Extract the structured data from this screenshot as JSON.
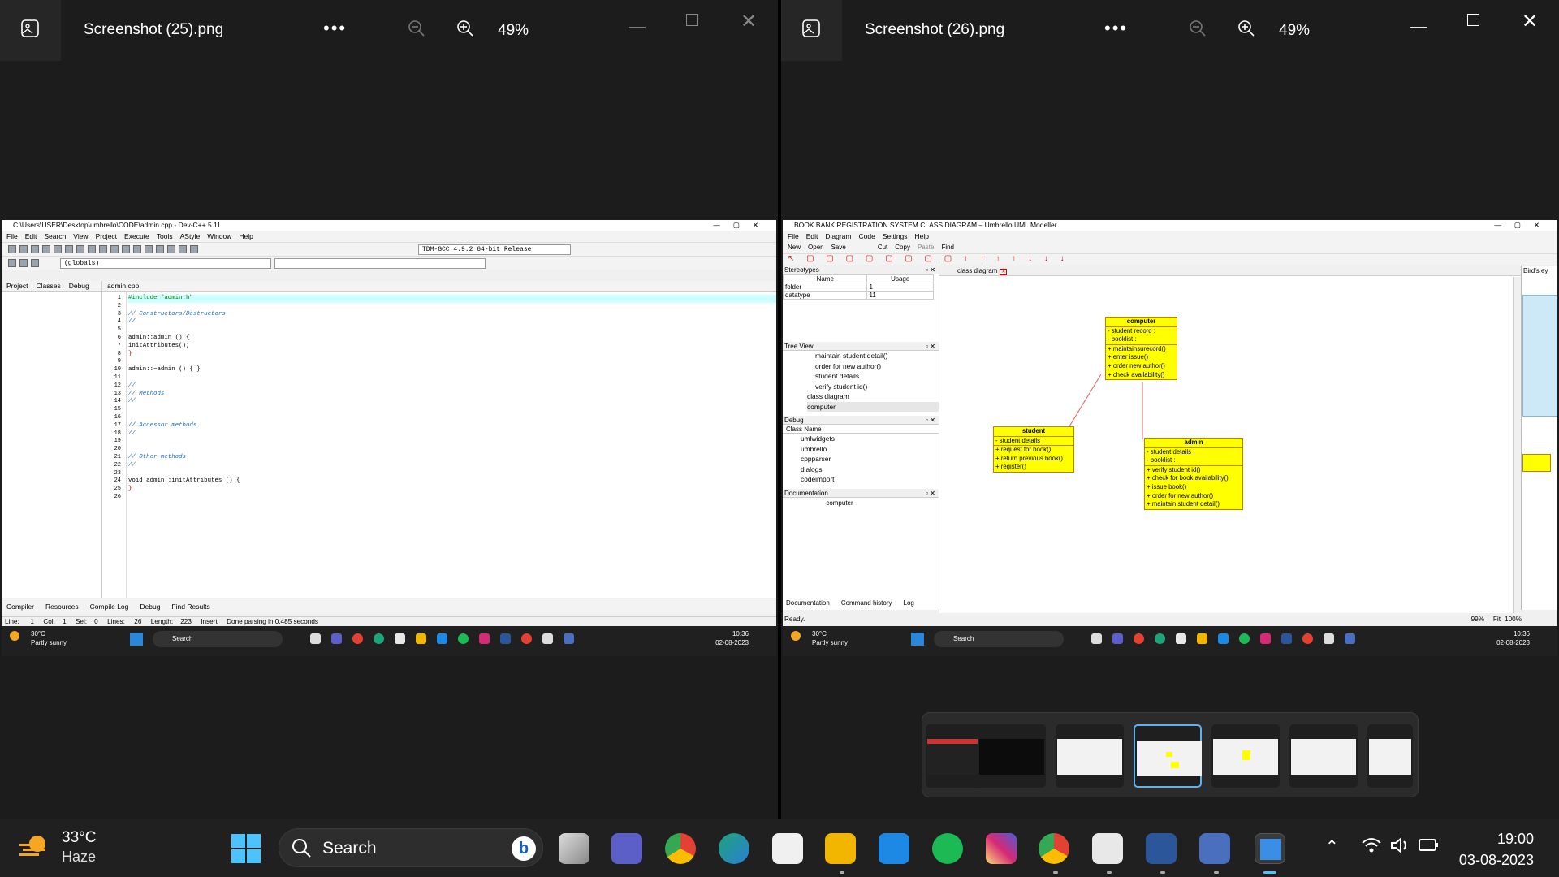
{
  "viewer_left": {
    "filename": "Screenshot (25).png",
    "zoom": "49%",
    "more": "•••"
  },
  "viewer_right": {
    "filename": "Screenshot (26).png",
    "zoom": "49%",
    "more": "•••"
  },
  "devcpp": {
    "title": "C:\\Users\\USER\\Desktop\\umbrello\\CODE\\admin.cpp - Dev-C++ 5.11",
    "menu": [
      "File",
      "Edit",
      "Search",
      "View",
      "Project",
      "Execute",
      "Tools",
      "AStyle",
      "Window",
      "Help"
    ],
    "compiler": "TDM-GCC 4.9.2 64-bit Release",
    "scope": "(globals)",
    "left_tabs": [
      "Project",
      "Classes",
      "Debug"
    ],
    "file_tab": "admin.cpp",
    "line_numbers": [
      "1",
      "2",
      "3",
      "4",
      "5",
      "6",
      "7",
      "8",
      "9",
      "10",
      "11",
      "12",
      "13",
      "14",
      "15",
      "16",
      "17",
      "18",
      "19",
      "20",
      "21",
      "22",
      "23",
      "24",
      "25",
      "26"
    ],
    "code": {
      "l1": "#include \"admin.h\"",
      "l3": "// Constructors/Destructors",
      "l4": "//",
      "l6": "admin::admin () {",
      "l7": "initAttributes();",
      "l8": "}",
      "l10": "admin::~admin () { }",
      "l12": "//",
      "l13": "// Methods",
      "l14": "//",
      "l17": "// Accessor methods",
      "l18": "//",
      "l21": "// Other methods",
      "l22": "//",
      "l24": "void admin::initAttributes () {",
      "l25": "}"
    },
    "bottom_tabs": [
      "Compiler",
      "Resources",
      "Compile Log",
      "Debug",
      "Find Results"
    ],
    "status": {
      "line": "Line:      1",
      "col": "Col:    1",
      "sel": "Sel:    0",
      "lines": "Lines:     26",
      "length": "Length:    223",
      "mode": "Insert",
      "msg": "Done parsing in 0.485 seconds"
    }
  },
  "mini_taskbar": {
    "temp": "30°C",
    "cond": "Partly sunny",
    "search": "Search",
    "time": "10:36",
    "date": "02-08-2023"
  },
  "umbrello": {
    "title": "BOOK BANK REGISTRATION SYSTEM CLASS DIAGRAM – Umbrello UML Modeller",
    "menu": [
      "File",
      "Edit",
      "Diagram",
      "Code",
      "Settings",
      "Help"
    ],
    "toolbar": [
      "New",
      "Open",
      "Save",
      "Cut",
      "Copy",
      "Paste",
      "Find"
    ],
    "stereotypes": {
      "title": "Stereotypes",
      "cols": [
        "Name",
        "Usage"
      ],
      "rows": [
        [
          "folder",
          "1"
        ],
        [
          "datatype",
          "11"
        ]
      ]
    },
    "tree": {
      "title": "Tree View",
      "items": [
        "maintain student detail()",
        "order for new author()",
        "student details :",
        "verify student id()",
        "class diagram",
        "computer"
      ]
    },
    "debug": {
      "title": "Debug",
      "col": "Class Name",
      "items": [
        "umlwidgets",
        "umbrello",
        "cppparser",
        "dialogs",
        "codeimport"
      ]
    },
    "documentation": {
      "title": "Documentation",
      "value": "computer"
    },
    "doc_tabs": [
      "Documentation",
      "Command history",
      "Log"
    ],
    "diagram_tab": "class diagram",
    "birds_eye": "Bird's ey",
    "status": "Ready.",
    "zoom": "99%",
    "fit": "Fit",
    "zoom100": "100%",
    "classes": {
      "computer": {
        "name": "computer",
        "attrs": [
          "- student record :",
          "- booklist :"
        ],
        "ops": [
          "+ maintainsurecord()",
          "+ enter issue()",
          "+ order new author()",
          "+ check availability()"
        ]
      },
      "student": {
        "name": "student",
        "attrs": [
          "- student details :"
        ],
        "ops": [
          "+ request for book()",
          "+ return previous book()",
          "+ register()"
        ]
      },
      "admin": {
        "name": "admin",
        "attrs": [
          "- student details :",
          "- booklist :"
        ],
        "ops": [
          "+ verify student id()",
          "+ check for book availability()",
          "+ issue book()",
          "+ order for new author()",
          "+ maintain student detail()"
        ]
      }
    }
  },
  "taskbar": {
    "temp": "33°C",
    "cond": "Haze",
    "search": "Search",
    "time": "19:00",
    "date": "03-08-2023"
  },
  "colors": {
    "accent": "#5bb3f0",
    "uml_fill": "#ffff00",
    "uml_line": "#e06060"
  }
}
